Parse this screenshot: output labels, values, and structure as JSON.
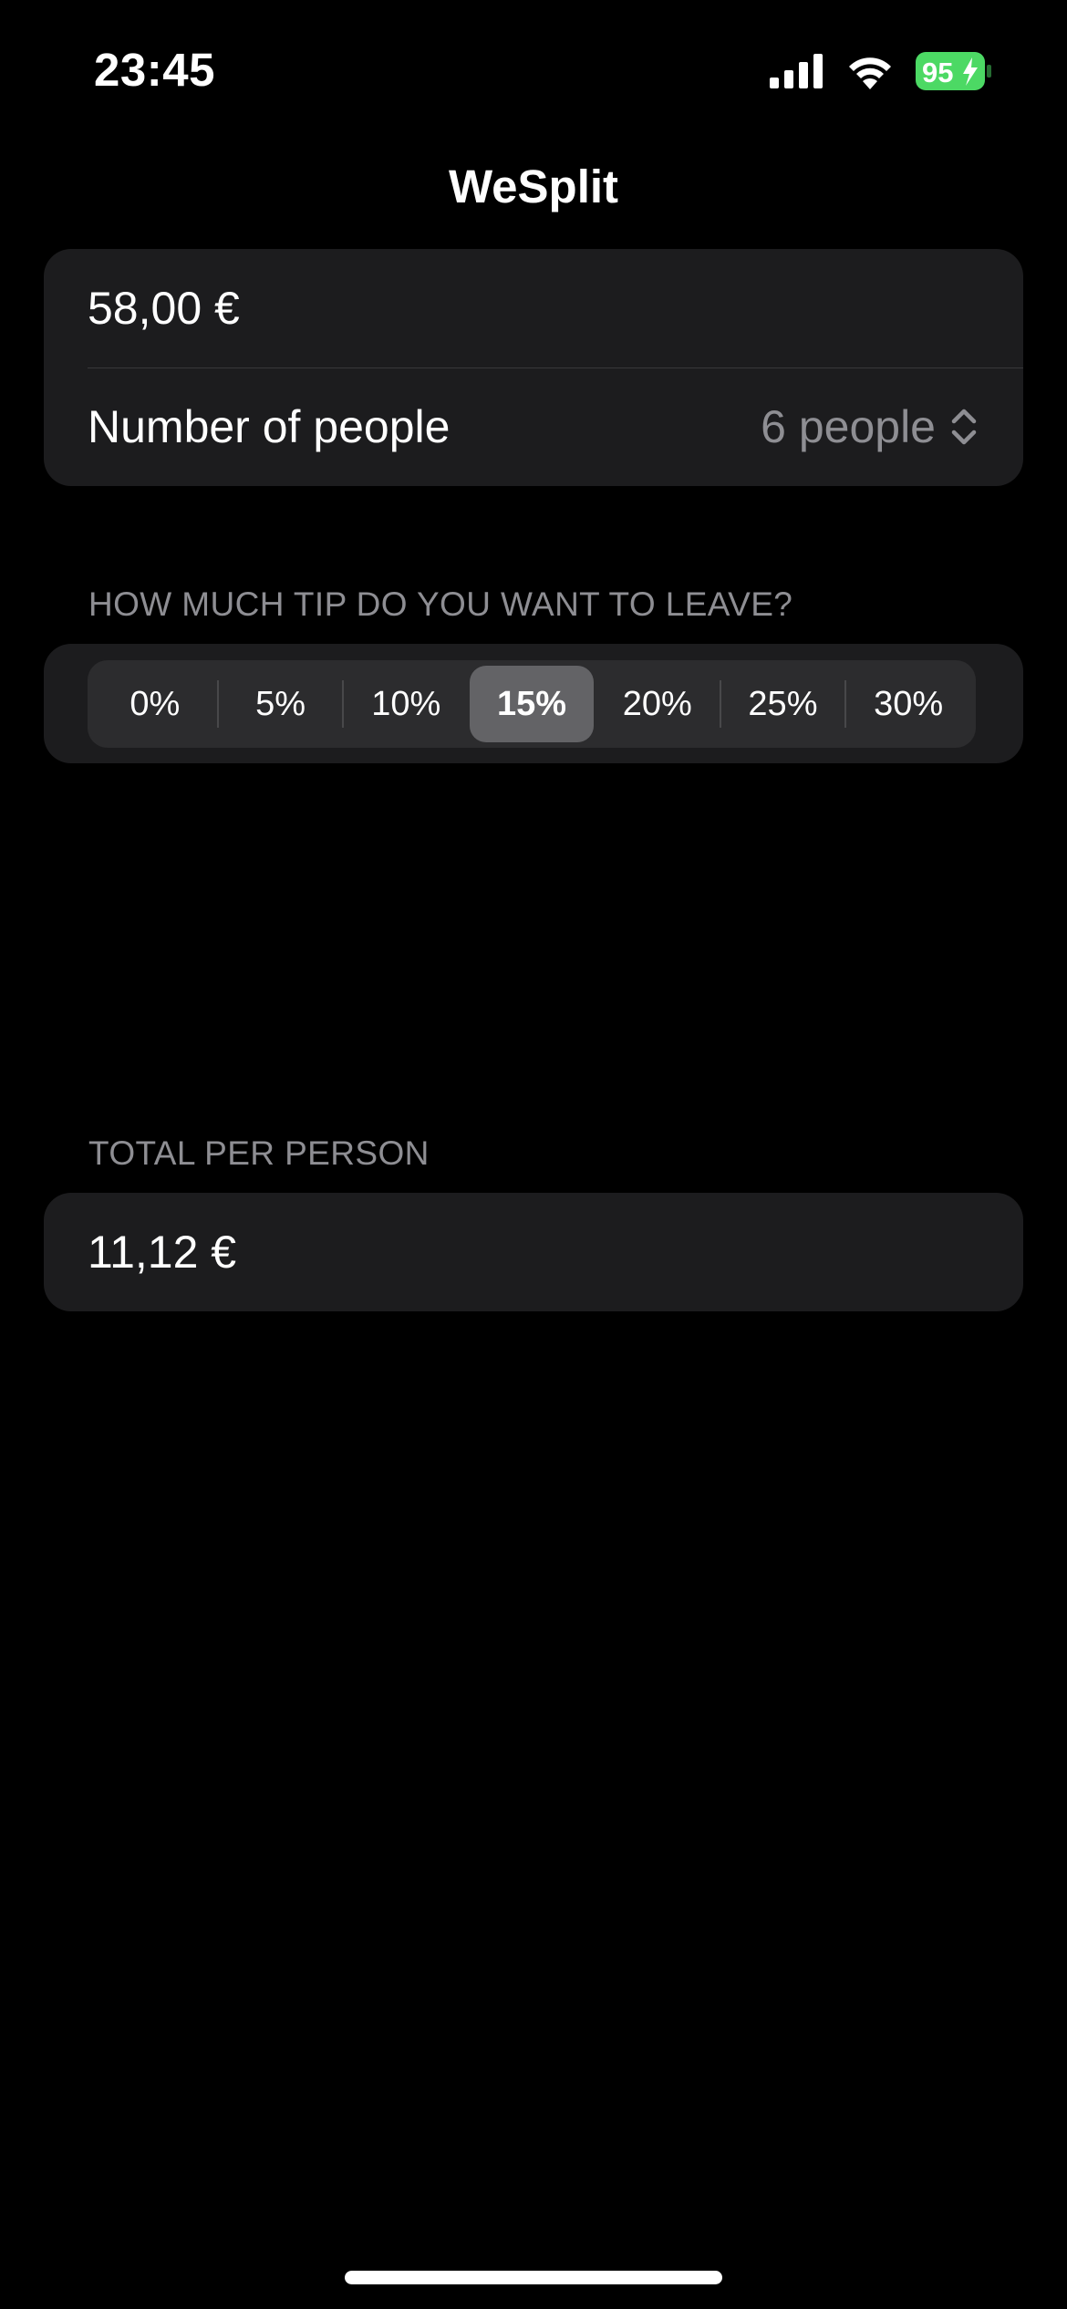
{
  "status_bar": {
    "time": "23:45",
    "battery_level": "95",
    "icons": [
      "signal-icon",
      "wifi-icon",
      "battery-charging-icon"
    ],
    "battery_color": "#4cd964"
  },
  "nav": {
    "title": "WeSplit"
  },
  "form": {
    "amount_value": "58,00 €",
    "people_label": "Number of people",
    "people_value": "6 people"
  },
  "tip": {
    "header": "HOW MUCH TIP DO YOU WANT TO LEAVE?",
    "options": [
      "0%",
      "5%",
      "10%",
      "15%",
      "20%",
      "25%",
      "30%"
    ],
    "selected": "15%"
  },
  "total": {
    "header": "TOTAL PER PERSON",
    "value": "11,12 €"
  },
  "colors": {
    "background": "#000000",
    "group_background": "#1c1c1e",
    "secondary_text": "#8e8e93",
    "segment_selected": "#636366"
  }
}
